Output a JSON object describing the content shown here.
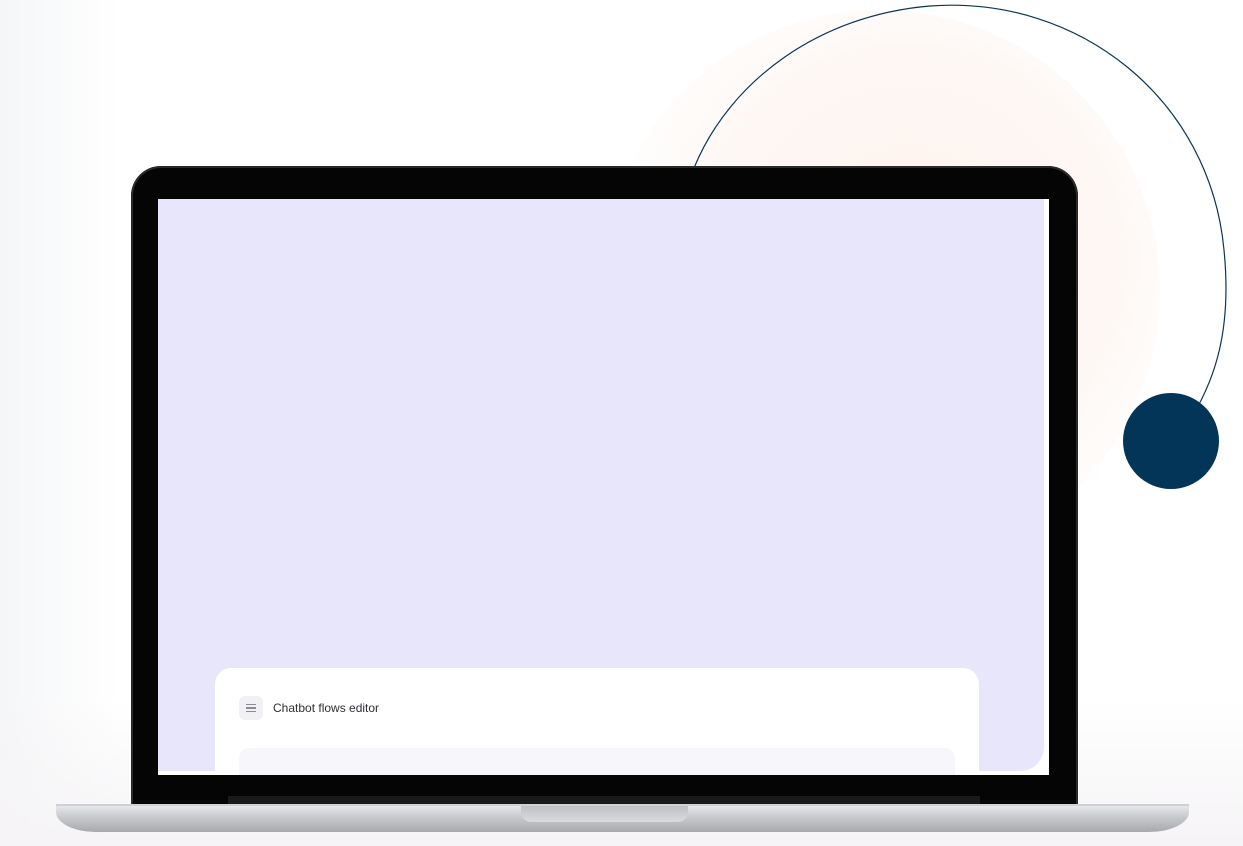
{
  "editor": {
    "title": "Chatbot flows editor",
    "menu_icon": "hamburger-menu-icon"
  },
  "colors": {
    "screen_background": "#e8e6fb",
    "accent_dot": "#023557",
    "arc_stroke": "#0b3558"
  }
}
